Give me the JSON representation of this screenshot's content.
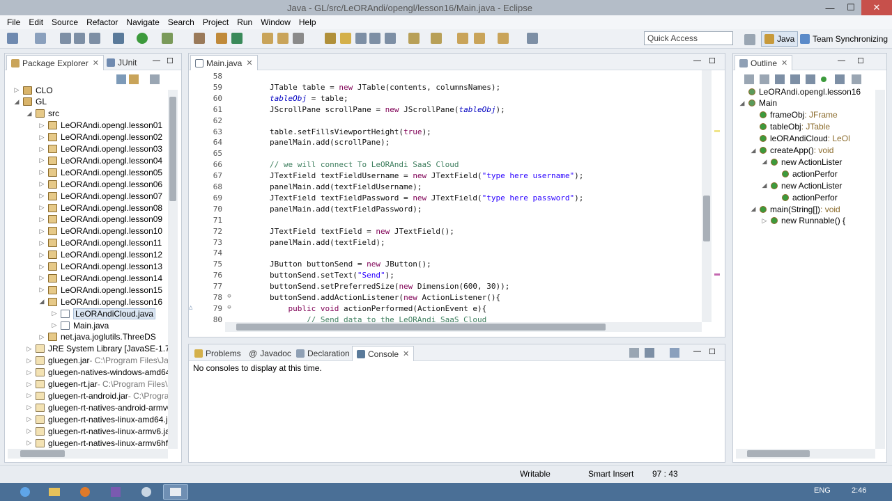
{
  "window": {
    "title": "Java - GL/src/LeORAndi/opengl/lesson16/Main.java - Eclipse",
    "minimize": "—",
    "maximize": "☐",
    "close": "✕"
  },
  "menubar": [
    "File",
    "Edit",
    "Source",
    "Refactor",
    "Navigate",
    "Search",
    "Project",
    "Run",
    "Window",
    "Help"
  ],
  "toolbar": {
    "quick_access_placeholder": "Quick Access",
    "perspectives": [
      "Java",
      "Team Synchronizing"
    ]
  },
  "package_explorer": {
    "tabs": [
      "Package Explorer",
      "JUnit"
    ],
    "items": [
      {
        "label": "CLO",
        "indent": 0,
        "twisty": "▷",
        "kind": "proj"
      },
      {
        "label": "GL",
        "indent": 0,
        "twisty": "◢",
        "kind": "proj"
      },
      {
        "label": "src",
        "indent": 1,
        "twisty": "◢",
        "kind": "pkg"
      },
      {
        "label": "LeORAndi.opengl.lesson01",
        "indent": 2,
        "twisty": "▷",
        "kind": "pkg"
      },
      {
        "label": "LeORAndi.opengl.lesson02",
        "indent": 2,
        "twisty": "▷",
        "kind": "pkg"
      },
      {
        "label": "LeORAndi.opengl.lesson03",
        "indent": 2,
        "twisty": "▷",
        "kind": "pkg"
      },
      {
        "label": "LeORAndi.opengl.lesson04",
        "indent": 2,
        "twisty": "▷",
        "kind": "pkg"
      },
      {
        "label": "LeORAndi.opengl.lesson05",
        "indent": 2,
        "twisty": "▷",
        "kind": "pkg"
      },
      {
        "label": "LeORAndi.opengl.lesson06",
        "indent": 2,
        "twisty": "▷",
        "kind": "pkg"
      },
      {
        "label": "LeORAndi.opengl.lesson07",
        "indent": 2,
        "twisty": "▷",
        "kind": "pkg"
      },
      {
        "label": "LeORAndi.opengl.lesson08",
        "indent": 2,
        "twisty": "▷",
        "kind": "pkg"
      },
      {
        "label": "LeORAndi.opengl.lesson09",
        "indent": 2,
        "twisty": "▷",
        "kind": "pkg"
      },
      {
        "label": "LeORAndi.opengl.lesson10",
        "indent": 2,
        "twisty": "▷",
        "kind": "pkg"
      },
      {
        "label": "LeORAndi.opengl.lesson11",
        "indent": 2,
        "twisty": "▷",
        "kind": "pkg"
      },
      {
        "label": "LeORAndi.opengl.lesson12",
        "indent": 2,
        "twisty": "▷",
        "kind": "pkg"
      },
      {
        "label": "LeORAndi.opengl.lesson13",
        "indent": 2,
        "twisty": "▷",
        "kind": "pkg"
      },
      {
        "label": "LeORAndi.opengl.lesson14",
        "indent": 2,
        "twisty": "▷",
        "kind": "pkg"
      },
      {
        "label": "LeORAndi.opengl.lesson15",
        "indent": 2,
        "twisty": "▷",
        "kind": "pkg"
      },
      {
        "label": "LeORAndi.opengl.lesson16",
        "indent": 2,
        "twisty": "◢",
        "kind": "pkg"
      },
      {
        "label": "LeORAndiCloud.java",
        "indent": 3,
        "twisty": "▷",
        "kind": "java",
        "selected": true
      },
      {
        "label": "Main.java",
        "indent": 3,
        "twisty": "▷",
        "kind": "java"
      },
      {
        "label": "net.java.joglutils.ThreeDS",
        "indent": 2,
        "twisty": "▷",
        "kind": "pkg"
      },
      {
        "label": "JRE System Library [JavaSE-1.7]",
        "indent": 1,
        "twisty": "▷",
        "kind": "jar"
      },
      {
        "label": "gluegen.jar",
        "suffix": " - C:\\Program Files\\Jav",
        "indent": 1,
        "twisty": "▷",
        "kind": "jar"
      },
      {
        "label": "gluegen-natives-windows-amd64.",
        "indent": 1,
        "twisty": "▷",
        "kind": "jar"
      },
      {
        "label": "gluegen-rt.jar",
        "suffix": " - C:\\Program Files\\J",
        "indent": 1,
        "twisty": "▷",
        "kind": "jar"
      },
      {
        "label": "gluegen-rt-android.jar",
        "suffix": " - C:\\Progra",
        "indent": 1,
        "twisty": "▷",
        "kind": "jar"
      },
      {
        "label": "gluegen-rt-natives-android-armv6",
        "indent": 1,
        "twisty": "▷",
        "kind": "jar"
      },
      {
        "label": "gluegen-rt-natives-linux-amd64.ja",
        "indent": 1,
        "twisty": "▷",
        "kind": "jar"
      },
      {
        "label": "gluegen-rt-natives-linux-armv6.ja",
        "indent": 1,
        "twisty": "▷",
        "kind": "jar"
      },
      {
        "label": "gluegen-rt-natives-linux-armv6hf.",
        "indent": 1,
        "twisty": "▷",
        "kind": "jar"
      }
    ]
  },
  "editor": {
    "tab": "Main.java",
    "lines": [
      {
        "n": "58",
        "html": ""
      },
      {
        "n": "59",
        "html": "<span class='plain'>JTable table = </span><span class='kw'>new</span><span class='plain'> JTable(contents, columnsNames);</span>"
      },
      {
        "n": "60",
        "html": "<span class='fld'>tableObj</span><span class='plain'> = table;</span>"
      },
      {
        "n": "61",
        "html": "<span class='plain'>JScrollPane scrollPane = </span><span class='kw'>new</span><span class='plain'> JScrollPane(</span><span class='fld'>tableObj</span><span class='plain'>);</span>"
      },
      {
        "n": "62",
        "html": ""
      },
      {
        "n": "63",
        "html": "<span class='plain'>table.setFillsViewportHeight(</span><span class='kw'>true</span><span class='plain'>);</span>"
      },
      {
        "n": "64",
        "html": "<span class='plain'>panelMain.add(scrollPane);</span>"
      },
      {
        "n": "65",
        "html": ""
      },
      {
        "n": "66",
        "html": "<span class='cmt'>// we will connect To LeORAndi SaaS Cloud</span>"
      },
      {
        "n": "67",
        "html": "<span class='plain'>JTextField textFieldUsername = </span><span class='kw'>new</span><span class='plain'> JTextField(</span><span class='str'>\"type here username\"</span><span class='plain'>);</span>"
      },
      {
        "n": "68",
        "html": "<span class='plain'>panelMain.add(textFieldUsername);</span>"
      },
      {
        "n": "69",
        "html": "<span class='plain'>JTextField textFieldPassword = </span><span class='kw'>new</span><span class='plain'> JTextField(</span><span class='str'>\"type here password\"</span><span class='plain'>);</span>"
      },
      {
        "n": "70",
        "html": "<span class='plain'>panelMain.add(textFieldPassword);</span>"
      },
      {
        "n": "71",
        "html": ""
      },
      {
        "n": "72",
        "html": "<span class='plain'>JTextField textField = </span><span class='kw'>new</span><span class='plain'> JTextField();</span>"
      },
      {
        "n": "73",
        "html": "<span class='plain'>panelMain.add(textField);</span>"
      },
      {
        "n": "74",
        "html": ""
      },
      {
        "n": "75",
        "html": "<span class='plain'>JButton buttonSend = </span><span class='kw'>new</span><span class='plain'> JButton();</span>"
      },
      {
        "n": "76",
        "html": "<span class='plain'>buttonSend.setText(</span><span class='str'>\"Send\"</span><span class='plain'>);</span>"
      },
      {
        "n": "77",
        "html": "<span class='plain'>buttonSend.setPreferredSize(</span><span class='kw'>new</span><span class='plain'> Dimension(600, 30));</span>"
      },
      {
        "n": "78",
        "html": "<span class='plain'>buttonSend.addActionListener(</span><span class='kw'>new</span><span class='plain'> ActionListener(){</span>",
        "fold": "⊖"
      },
      {
        "n": "79",
        "html": "<span class='plain'>    </span><span class='kw'>public void</span><span class='plain'> actionPerformed(ActionEvent e){</span>",
        "fold": "⊖",
        "marker": "△"
      },
      {
        "n": "80",
        "html": "<span class='cmt'>        // Send data to the LeORAndi SaaS Cloud</span>"
      }
    ]
  },
  "bottom_panel": {
    "tabs": [
      "Problems",
      "Javadoc",
      "Declaration",
      "Console"
    ],
    "message": "No consoles to display at this time."
  },
  "outline": {
    "tab": "Outline",
    "items": [
      {
        "label": "LeORAndi.opengl.lesson16",
        "indent": 0,
        "twisty": ""
      },
      {
        "label": "Main",
        "indent": 0,
        "twisty": "◢"
      },
      {
        "label": "frameObj",
        "type": " : JFrame",
        "indent": 1,
        "twisty": ""
      },
      {
        "label": "tableObj",
        "type": " : JTable",
        "indent": 1,
        "twisty": ""
      },
      {
        "label": "leORAndiCloud",
        "type": " : LeOl",
        "indent": 1,
        "twisty": ""
      },
      {
        "label": "createApp()",
        "type": " : void",
        "indent": 1,
        "twisty": "◢"
      },
      {
        "label": "new ActionLister",
        "indent": 2,
        "twisty": "◢"
      },
      {
        "label": "actionPerfor",
        "indent": 3,
        "twisty": ""
      },
      {
        "label": "new ActionLister",
        "indent": 2,
        "twisty": "◢"
      },
      {
        "label": "actionPerfor",
        "indent": 3,
        "twisty": ""
      },
      {
        "label": "main(String[])",
        "type": " : void",
        "indent": 1,
        "twisty": "◢"
      },
      {
        "label": "new Runnable() {",
        "indent": 2,
        "twisty": "▷"
      }
    ]
  },
  "statusbar": {
    "writable": "Writable",
    "insert_mode": "Smart Insert",
    "position": "97 : 43"
  },
  "taskbar": {
    "lang": "ENG",
    "time": "2:46"
  }
}
